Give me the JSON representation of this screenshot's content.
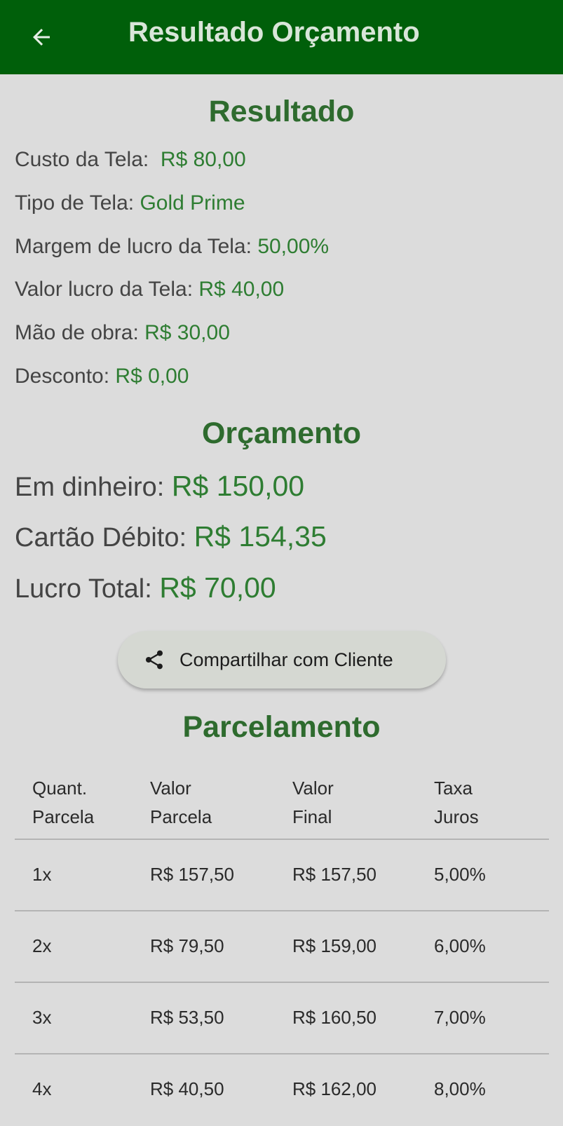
{
  "appbar": {
    "title": "Resultado Orçamento",
    "back_icon": "arrow-left-icon",
    "background": "#005f0a"
  },
  "resultado": {
    "title": "Resultado",
    "items": [
      {
        "label": "Custo da Tela:",
        "value": "R$ 80,00"
      },
      {
        "label": "Tipo de Tela:",
        "value": "Gold Prime"
      },
      {
        "label": "Margem de lucro da Tela:",
        "value": "50,00%"
      },
      {
        "label": "Valor lucro da Tela:",
        "value": "R$ 40,00"
      },
      {
        "label": "Mão de obra:",
        "value": "R$ 30,00"
      },
      {
        "label": "Desconto:",
        "value": "R$ 0,00"
      }
    ]
  },
  "orcamento": {
    "title": "Orçamento",
    "items": [
      {
        "label": "Em dinheiro:",
        "value": "R$ 150,00"
      },
      {
        "label": "Cartão Débito:",
        "value": "R$ 154,35"
      },
      {
        "label": "Lucro Total:",
        "value": "R$ 70,00"
      }
    ]
  },
  "share_button": {
    "label": "Compartilhar com Cliente",
    "icon": "share-icon"
  },
  "parcelamento": {
    "title": "Parcelamento",
    "headers": [
      {
        "line1": "Quant.",
        "line2": "Parcela"
      },
      {
        "line1": "Valor",
        "line2": "Parcela"
      },
      {
        "line1": "Valor",
        "line2": "Final"
      },
      {
        "line1": "Taxa",
        "line2": "Juros"
      }
    ],
    "rows": [
      [
        "1x",
        "R$ 157,50",
        "R$ 157,50",
        "5,00%"
      ],
      [
        "2x",
        "R$ 79,50",
        "R$ 159,00",
        "6,00%"
      ],
      [
        "3x",
        "R$ 53,50",
        "R$ 160,50",
        "7,00%"
      ],
      [
        "4x",
        "R$ 40,50",
        "R$ 162,00",
        "8,00%"
      ]
    ]
  },
  "colors": {
    "accent_green": "#2e7d32",
    "title_green": "#2e6b2e",
    "page_background": "#dcdcdc"
  }
}
